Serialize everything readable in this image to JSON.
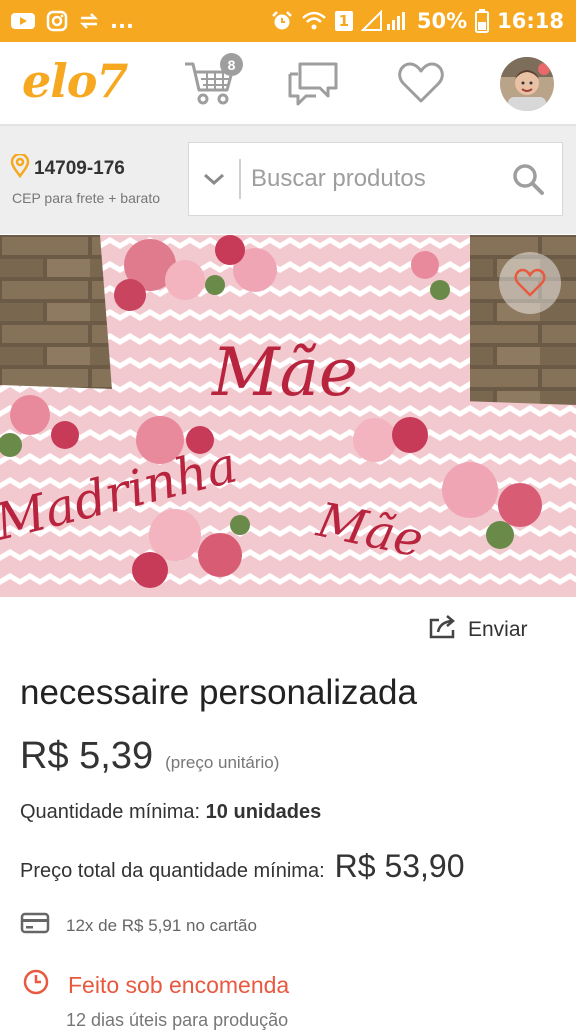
{
  "status_bar": {
    "battery": "50%",
    "time": "16:18",
    "ellipsis": "...",
    "sim_badge": "1"
  },
  "header": {
    "logo": "elo7",
    "cart_count": "8",
    "brand_color": "#f6a821"
  },
  "location": {
    "cep": "14709-176",
    "subtitle": "CEP para frete + barato"
  },
  "search": {
    "placeholder": "Buscar produtos"
  },
  "product": {
    "image_texts": [
      "Mãe",
      "Madrinha",
      "Mãe"
    ],
    "share_label": "Enviar",
    "title": "necessaire personalizada",
    "price": "R$ 5,39",
    "price_note": "(preço unitário)",
    "min_qty_label": "Quantidade mínima:",
    "min_qty_value": "10 unidades",
    "total_label": "Preço total da quantidade mínima:",
    "total_value": "R$ 53,90",
    "installments": "12x de R$ 5,91 no cartão",
    "made_to_order": "Feito sob encomenda",
    "production_time": "12 dias úteis para produção",
    "accent_color": "#e8593f"
  },
  "icons": [
    "youtube-icon",
    "instagram-icon",
    "transfer-icon",
    "alarm-icon",
    "wifi-icon",
    "signal-icon",
    "battery-icon",
    "cart-icon",
    "chat-icon",
    "heart-icon",
    "location-pin-icon",
    "chevron-down-icon",
    "search-icon",
    "share-icon",
    "credit-card-icon",
    "clock-icon"
  ]
}
